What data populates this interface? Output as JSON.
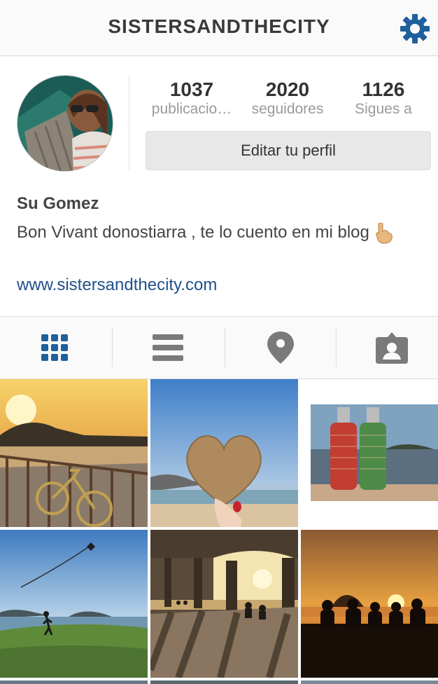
{
  "header": {
    "title": "SISTERSANDTHECITY",
    "settings_icon": "gear-icon",
    "accent_color": "#1f5f9c"
  },
  "profile": {
    "avatar": "profile-photo",
    "stats": [
      {
        "value": "1037",
        "label": "publicacio…"
      },
      {
        "value": "2020",
        "label": "seguidores"
      },
      {
        "value": "1126",
        "label": "Sigues a"
      }
    ],
    "edit_button": "Editar tu perfil",
    "name": "Su Gomez",
    "bio": "Bon Vivant donostiarra , te lo cuento en mi blog",
    "bio_emoji_icon": "pointing-down-hand-icon",
    "website": "www.sistersandthecity.com",
    "link_color": "#20518a"
  },
  "tabs": [
    {
      "icon": "grid-icon",
      "active": true
    },
    {
      "icon": "list-icon",
      "active": false
    },
    {
      "icon": "location-pin-icon",
      "active": false
    },
    {
      "icon": "tagged-photos-icon",
      "active": false
    }
  ],
  "photos": [
    {
      "subject": "sunset-promenade-bicycle"
    },
    {
      "subject": "heart-shaped-potato-beach"
    },
    {
      "subject": "soda-siphons-bay"
    },
    {
      "subject": "kite-on-hill"
    },
    {
      "subject": "arcade-beach-sunset"
    },
    {
      "subject": "silhouettes-sunset"
    }
  ]
}
